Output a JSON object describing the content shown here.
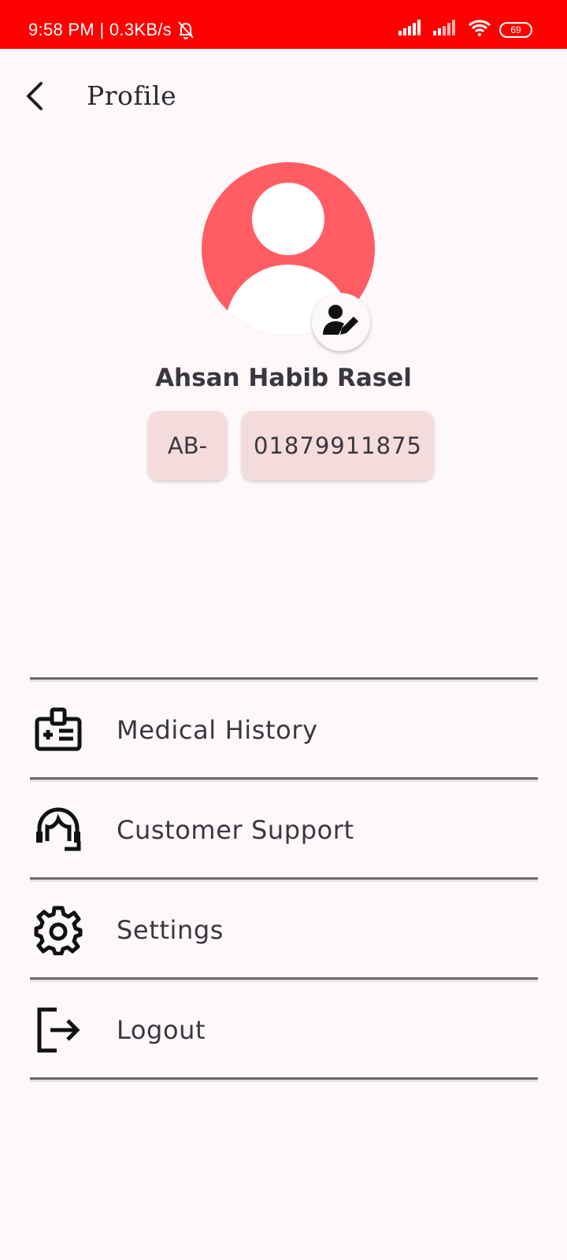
{
  "status_bar": {
    "time_speed": "9:58 PM | 0.3KB/s",
    "battery": "69"
  },
  "header": {
    "title": "Profile"
  },
  "profile": {
    "name": "Ahsan Habib Rasel",
    "blood_group": "AB-",
    "phone": "01879911875"
  },
  "menu": {
    "items": [
      {
        "label": "Medical History",
        "icon": "medical-id-icon"
      },
      {
        "label": "Customer Support",
        "icon": "support-agent-icon"
      },
      {
        "label": "Settings",
        "icon": "gear-icon"
      },
      {
        "label": "Logout",
        "icon": "logout-icon"
      }
    ]
  },
  "colors": {
    "status_bar": "#ff0000",
    "avatar": "#ff5d63",
    "chip": "#f5dcdc",
    "background": "#fdf8fa"
  }
}
